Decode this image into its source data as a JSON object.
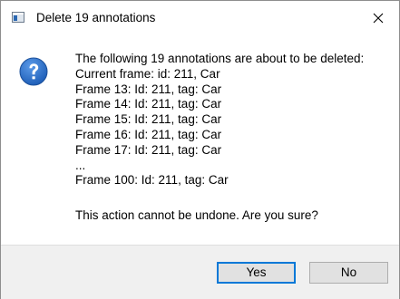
{
  "window": {
    "title": "Delete 19 annotations"
  },
  "message": {
    "lines": [
      "The following 19 annotations are about to be deleted:",
      "Current frame: id: 211, Car",
      "Frame 13: Id: 211, tag: Car",
      "Frame 14: Id: 211, tag: Car",
      "Frame 15: Id: 211, tag: Car",
      "Frame 16: Id: 211, tag: Car",
      "Frame 17: Id: 211, tag: Car",
      "...",
      "Frame 100: Id: 211, tag: Car"
    ],
    "confirm": "This action cannot be undone. Are you sure?"
  },
  "buttons": {
    "yes": "Yes",
    "no": "No"
  },
  "icons": {
    "app": "dialog-window-icon",
    "question": "question-icon",
    "close": "close-icon"
  },
  "colors": {
    "focus_border": "#0078d7",
    "question_blue": "#1f5fb8",
    "footer_bg": "#f0f0f0"
  }
}
